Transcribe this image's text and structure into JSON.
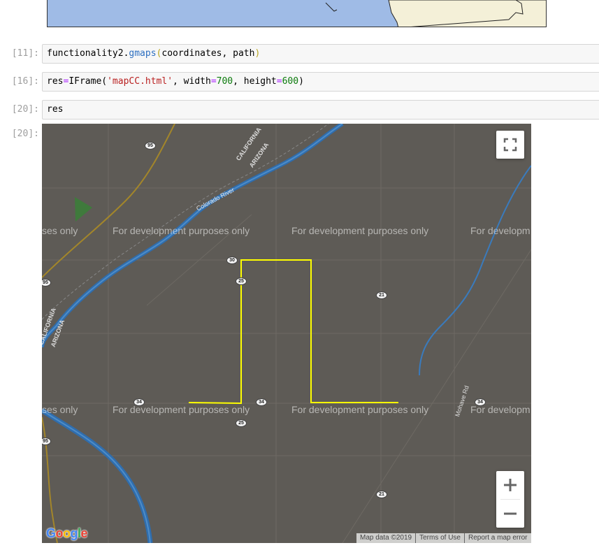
{
  "cells": [
    {
      "prompt": "[11]:",
      "code": "functionality2.gmaps(coordinates, path)"
    },
    {
      "prompt": "[16]:",
      "code": "res=IFrame('mapCC.html', width=700, height=600)"
    },
    {
      "prompt": "[20]:",
      "code": "res"
    }
  ],
  "output": {
    "prompt": "[20]:",
    "map": {
      "watermark": "For development purposes only",
      "watermark_partial_left": "ses only",
      "watermark_partial_right": "For developm",
      "labels": {
        "california_top": "CALIFORNIA",
        "arizona_top": "ARIZONA",
        "california_left": "CALIFORNIA",
        "arizona_left": "ARIZONA",
        "colorado_river": "Colorado River",
        "mohave_rd": "Mohave Rd"
      },
      "shields": {
        "s95_top": "95",
        "s95_left": "95",
        "s95_bottom": "95",
        "s30": "30",
        "s25_a": "25",
        "s25_b": "25",
        "s21_a": "21",
        "s21_b": "21",
        "s34_a": "34",
        "s34_b": "34",
        "s34_c": "34"
      },
      "path_color": "#ffff00",
      "attribution": {
        "map_data": "Map data ©2019",
        "terms": "Terms of Use",
        "report": "Report a map error"
      },
      "logo": "Google",
      "controls": {
        "fullscreen_icon": "fullscreen-icon",
        "zoom_in_icon": "plus-icon",
        "zoom_out_icon": "minus-icon"
      }
    }
  }
}
